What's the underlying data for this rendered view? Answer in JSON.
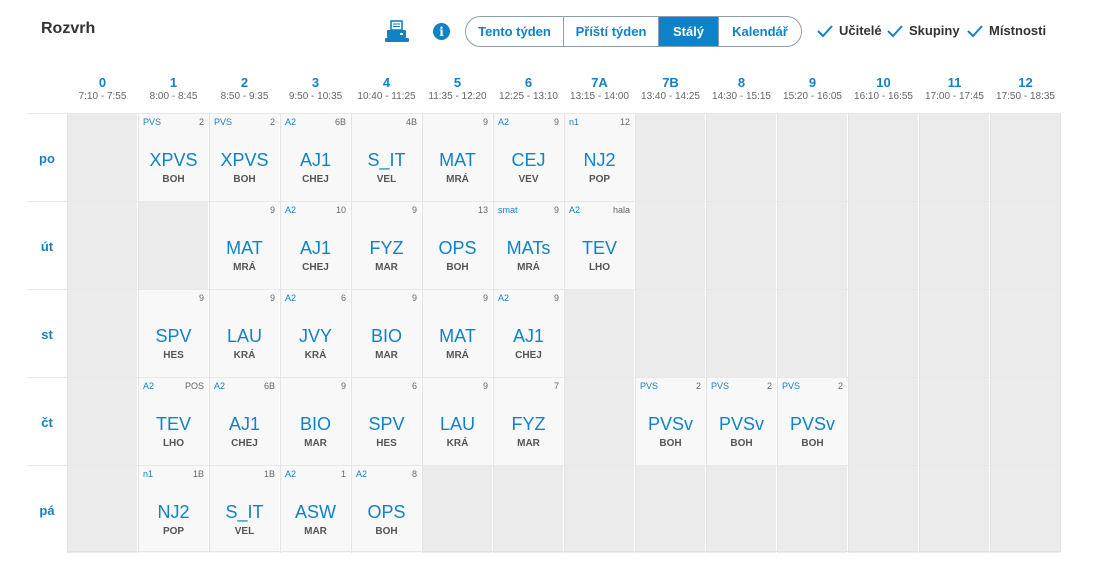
{
  "header": {
    "title": "Rozvrh",
    "print_icon": "printer-icon",
    "info_icon": "info-icon",
    "info_glyph": "i",
    "tabs": [
      {
        "label": "Tento týden",
        "active": false
      },
      {
        "label": "Příští týden",
        "active": false
      },
      {
        "label": "Stálý",
        "active": true
      },
      {
        "label": "Kalendář",
        "active": false
      }
    ],
    "toggles": [
      {
        "label": "Učitelé",
        "checked": true
      },
      {
        "label": "Skupiny",
        "checked": true
      },
      {
        "label": "Místnosti",
        "checked": true
      }
    ]
  },
  "colors": {
    "accent": "#1181c8",
    "lesson_bg": "#f8f8f8",
    "empty_bg": "#ebebeb"
  },
  "hours": [
    {
      "num": "0",
      "time": "7:10 - 7:55"
    },
    {
      "num": "1",
      "time": "8:00 - 8:45"
    },
    {
      "num": "2",
      "time": "8:50 - 9:35"
    },
    {
      "num": "3",
      "time": "9:50 - 10:35"
    },
    {
      "num": "4",
      "time": "10:40 - 11:25"
    },
    {
      "num": "5",
      "time": "11:35 - 12:20"
    },
    {
      "num": "6",
      "time": "12:25 - 13:10"
    },
    {
      "num": "7A",
      "time": "13:15 - 14:00"
    },
    {
      "num": "7B",
      "time": "13:40 - 14:25"
    },
    {
      "num": "8",
      "time": "14:30 - 15:15"
    },
    {
      "num": "9",
      "time": "15:20 - 16:05"
    },
    {
      "num": "10",
      "time": "16:10 - 16:55"
    },
    {
      "num": "11",
      "time": "17:00 - 17:45"
    },
    {
      "num": "12",
      "time": "17:50 - 18:35"
    }
  ],
  "days": [
    {
      "label": "po",
      "cells": [
        null,
        {
          "group": "PVS",
          "room": "2",
          "subject": "XPVS",
          "teacher": "BOH"
        },
        {
          "group": "PVS",
          "room": "2",
          "subject": "XPVS",
          "teacher": "BOH"
        },
        {
          "group": "A2",
          "room": "6B",
          "subject": "AJ1",
          "teacher": "CHEJ"
        },
        {
          "group": "",
          "room": "4B",
          "subject": "S_IT",
          "teacher": "VEL"
        },
        {
          "group": "",
          "room": "9",
          "subject": "MAT",
          "teacher": "MRÁ"
        },
        {
          "group": "A2",
          "room": "9",
          "subject": "CEJ",
          "teacher": "VEV"
        },
        {
          "group": "n1",
          "room": "12",
          "subject": "NJ2",
          "teacher": "POP"
        },
        null,
        null,
        null,
        null,
        null,
        null
      ]
    },
    {
      "label": "út",
      "cells": [
        null,
        null,
        {
          "group": "",
          "room": "9",
          "subject": "MAT",
          "teacher": "MRÁ"
        },
        {
          "group": "A2",
          "room": "10",
          "subject": "AJ1",
          "teacher": "CHEJ"
        },
        {
          "group": "",
          "room": "9",
          "subject": "FYZ",
          "teacher": "MAR"
        },
        {
          "group": "",
          "room": "13",
          "subject": "OPS",
          "teacher": "BOH"
        },
        {
          "group": "smat",
          "room": "9",
          "subject": "MATs",
          "teacher": "MRÁ"
        },
        {
          "group": "A2",
          "room": "hala",
          "subject": "TEV",
          "teacher": "LHO"
        },
        null,
        null,
        null,
        null,
        null,
        null
      ]
    },
    {
      "label": "st",
      "cells": [
        null,
        {
          "group": "",
          "room": "9",
          "subject": "SPV",
          "teacher": "HES"
        },
        {
          "group": "",
          "room": "9",
          "subject": "LAU",
          "teacher": "KRÁ"
        },
        {
          "group": "A2",
          "room": "6",
          "subject": "JVY",
          "teacher": "KRÁ"
        },
        {
          "group": "",
          "room": "9",
          "subject": "BIO",
          "teacher": "MAR"
        },
        {
          "group": "",
          "room": "9",
          "subject": "MAT",
          "teacher": "MRÁ"
        },
        {
          "group": "A2",
          "room": "9",
          "subject": "AJ1",
          "teacher": "CHEJ"
        },
        null,
        null,
        null,
        null,
        null,
        null,
        null
      ]
    },
    {
      "label": "čt",
      "cells": [
        null,
        {
          "group": "A2",
          "room": "POS",
          "subject": "TEV",
          "teacher": "LHO"
        },
        {
          "group": "A2",
          "room": "6B",
          "subject": "AJ1",
          "teacher": "CHEJ"
        },
        {
          "group": "",
          "room": "9",
          "subject": "BIO",
          "teacher": "MAR"
        },
        {
          "group": "",
          "room": "6",
          "subject": "SPV",
          "teacher": "HES"
        },
        {
          "group": "",
          "room": "9",
          "subject": "LAU",
          "teacher": "KRÁ"
        },
        {
          "group": "",
          "room": "7",
          "subject": "FYZ",
          "teacher": "MAR"
        },
        null,
        {
          "group": "PVS",
          "room": "2",
          "subject": "PVSv",
          "teacher": "BOH"
        },
        {
          "group": "PVS",
          "room": "2",
          "subject": "PVSv",
          "teacher": "BOH"
        },
        {
          "group": "PVS",
          "room": "2",
          "subject": "PVSv",
          "teacher": "BOH"
        },
        null,
        null,
        null
      ]
    },
    {
      "label": "pá",
      "cells": [
        null,
        {
          "group": "n1",
          "room": "1B",
          "subject": "NJ2",
          "teacher": "POP"
        },
        {
          "group": "",
          "room": "1B",
          "subject": "S_IT",
          "teacher": "VEL"
        },
        {
          "group": "A2",
          "room": "1",
          "subject": "ASW",
          "teacher": "MAR"
        },
        {
          "group": "A2",
          "room": "8",
          "subject": "OPS",
          "teacher": "BOH"
        },
        null,
        null,
        null,
        null,
        null,
        null,
        null,
        null,
        null
      ]
    }
  ]
}
